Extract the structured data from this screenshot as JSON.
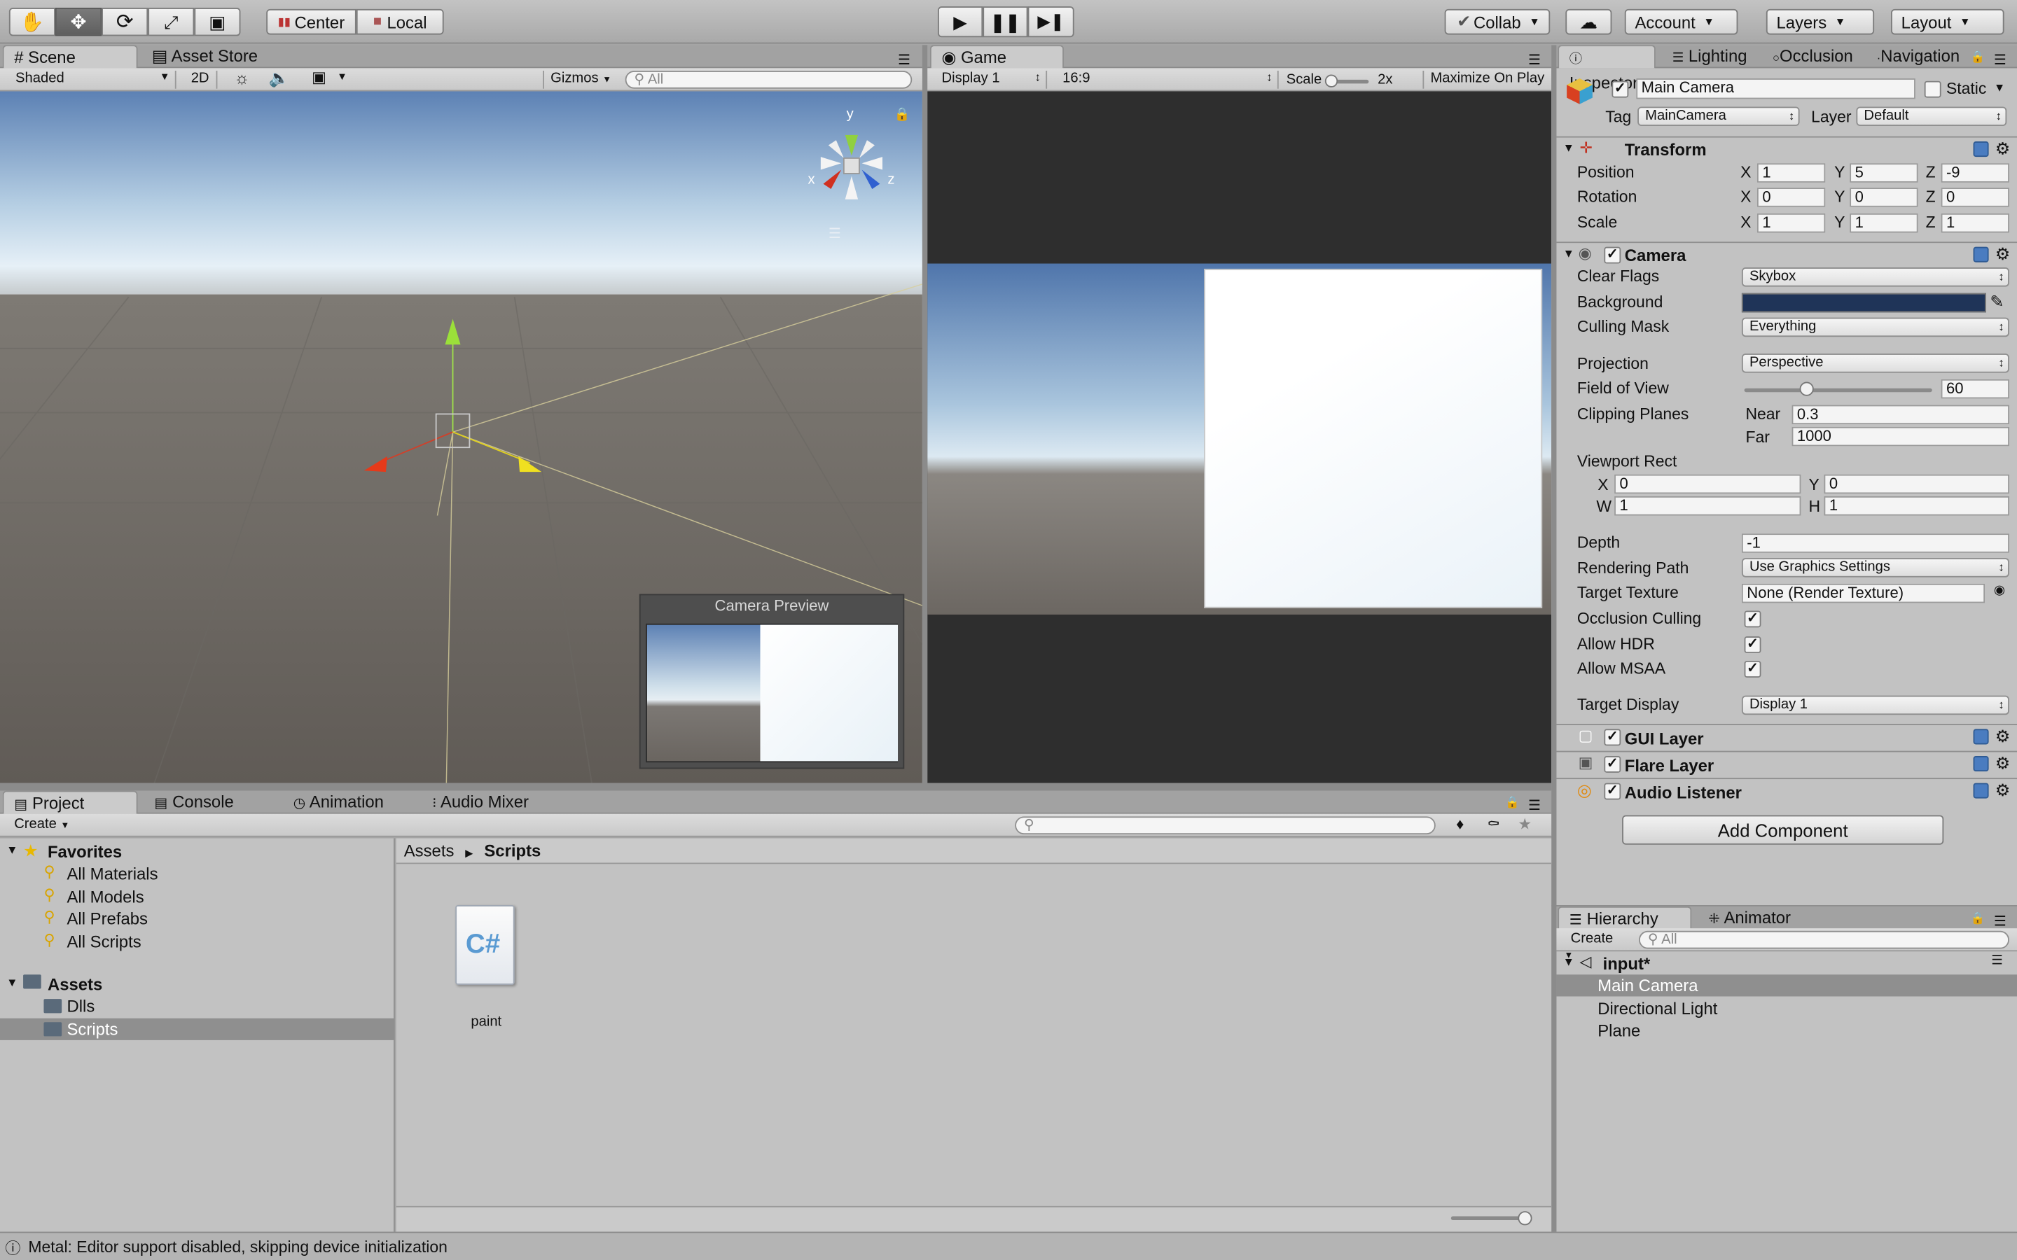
{
  "toolbar": {
    "tools": [
      "hand-tool",
      "move-tool",
      "rotate-tool",
      "scale-tool",
      "rect-tool"
    ],
    "pivot_label": "Center",
    "space_label": "Local",
    "collab_label": "Collab",
    "account_label": "Account",
    "layers_label": "Layers",
    "layout_label": "Layout"
  },
  "scene": {
    "tab_label": "Scene",
    "asset_store_tab": "Asset Store",
    "shading_mode": "Shaded",
    "mode_2d": "2D",
    "gizmos_label": "Gizmos",
    "search_placeholder": "All",
    "gizmo_axes": {
      "y": "y",
      "x": "x",
      "z": "z"
    },
    "camera_preview_title": "Camera Preview"
  },
  "game": {
    "tab_label": "Game",
    "display": "Display 1",
    "aspect": "16:9",
    "scale_label": "Scale",
    "scale_value": "2x",
    "maximize_label": "Maximize On Play"
  },
  "inspector": {
    "tabs": [
      "Inspector",
      "Lighting",
      "Occlusion",
      "Navigation"
    ],
    "object_name": "Main Camera",
    "static_label": "Static",
    "tag_label": "Tag",
    "tag_value": "MainCamera",
    "layer_label": "Layer",
    "layer_value": "Default",
    "transform": {
      "title": "Transform",
      "rows": [
        {
          "label": "Position",
          "x": "1",
          "y": "5",
          "z": "-9"
        },
        {
          "label": "Rotation",
          "x": "0",
          "y": "0",
          "z": "0"
        },
        {
          "label": "Scale",
          "x": "1",
          "y": "1",
          "z": "1"
        }
      ]
    },
    "camera": {
      "title": "Camera",
      "clear_flags_label": "Clear Flags",
      "clear_flags": "Skybox",
      "background_label": "Background",
      "background_color": "#1f3458",
      "culling_mask_label": "Culling Mask",
      "culling_mask": "Everything",
      "projection_label": "Projection",
      "projection": "Perspective",
      "fov_label": "Field of View",
      "fov": "60",
      "fov_slider": 0.33,
      "clipping_label": "Clipping Planes",
      "near_label": "Near",
      "near": "0.3",
      "far_label": "Far",
      "far": "1000",
      "viewport_label": "Viewport Rect",
      "vx": "0",
      "vy": "0",
      "vw": "1",
      "vh": "1",
      "depth_label": "Depth",
      "depth": "-1",
      "rendering_path_label": "Rendering Path",
      "rendering_path": "Use Graphics Settings",
      "target_texture_label": "Target Texture",
      "target_texture": "None (Render Texture)",
      "occlusion_label": "Occlusion Culling",
      "hdr_label": "Allow HDR",
      "msaa_label": "Allow MSAA",
      "target_display_label": "Target Display",
      "target_display": "Display 1"
    },
    "components": [
      "GUI Layer",
      "Flare Layer",
      "Audio Listener"
    ],
    "add_component": "Add Component"
  },
  "project": {
    "tabs": [
      "Project",
      "Console",
      "Animation",
      "Audio Mixer"
    ],
    "create_label": "Create",
    "favorites_label": "Favorites",
    "favorites": [
      "All Materials",
      "All Models",
      "All Prefabs",
      "All Scripts"
    ],
    "assets_label": "Assets",
    "asset_folders": [
      "Dlls",
      "Scripts"
    ],
    "breadcrumb": [
      "Assets",
      "Scripts"
    ],
    "file_name": "paint",
    "file_glyph": "C#"
  },
  "hierarchy": {
    "tabs": [
      "Hierarchy",
      "Animator"
    ],
    "create_label": "Create",
    "search_placeholder": "All",
    "scene_name": "input*",
    "items": [
      "Main Camera",
      "Directional Light",
      "Plane"
    ]
  },
  "status": {
    "message": "Metal: Editor support disabled, skipping device initialization"
  }
}
